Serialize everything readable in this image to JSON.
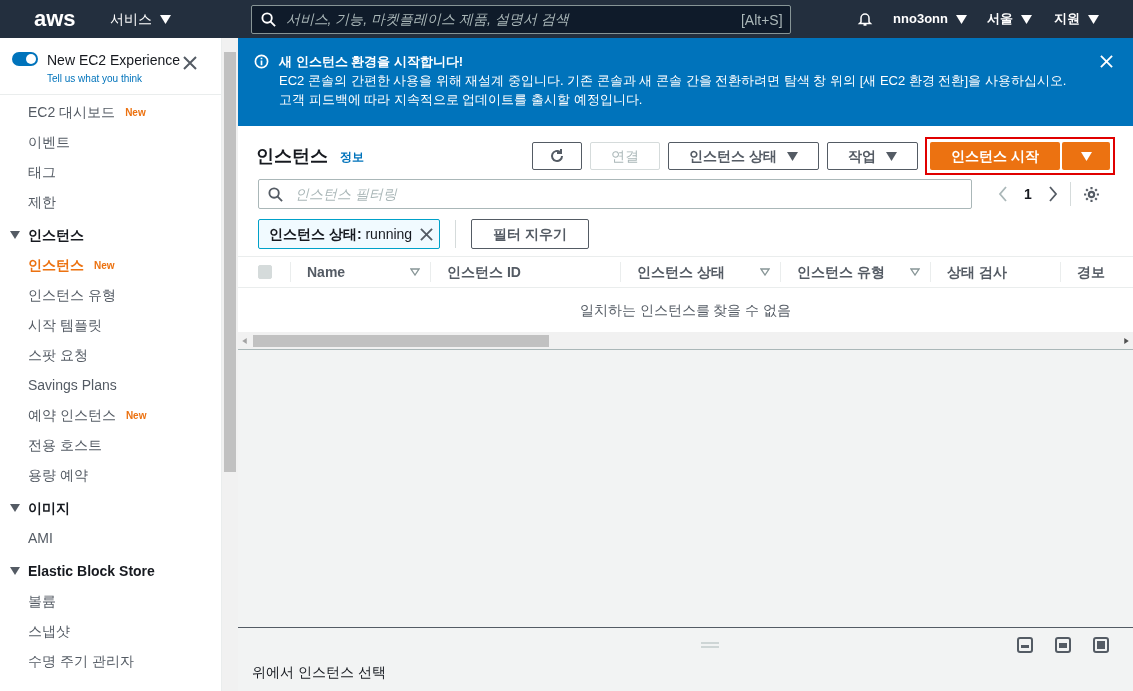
{
  "topbar": {
    "logo": "aws",
    "services": "서비스",
    "search_placeholder": "서비스, 기능, 마켓플레이스 제품, 설명서 검색",
    "search_shortcut": "[Alt+S]",
    "account": "nno3onn",
    "region": "서울",
    "support": "지원"
  },
  "sidebar": {
    "experience": {
      "title": "New EC2 Experience",
      "link": "Tell us what you think",
      "on": true
    },
    "groups": [
      {
        "items": [
          {
            "label": "EC2 대시보드",
            "badge": "New",
            "selected": false
          },
          {
            "label": "이벤트",
            "selected": false
          },
          {
            "label": "태그",
            "selected": false
          },
          {
            "label": "제한",
            "selected": false
          }
        ]
      },
      {
        "heading": "인스턴스",
        "expanded": true,
        "items": [
          {
            "label": "인스턴스",
            "badge": "New",
            "selected": true
          },
          {
            "label": "인스턴스 유형",
            "selected": false
          },
          {
            "label": "시작 템플릿",
            "selected": false
          },
          {
            "label": "스팟 요청",
            "selected": false
          },
          {
            "label": "Savings Plans",
            "selected": false
          },
          {
            "label": "예약 인스턴스",
            "badge": "New",
            "selected": false
          },
          {
            "label": "전용 호스트",
            "selected": false
          },
          {
            "label": "용량 예약",
            "selected": false
          }
        ]
      },
      {
        "heading": "이미지",
        "expanded": true,
        "items": [
          {
            "label": "AMI",
            "selected": false
          }
        ]
      },
      {
        "heading": "Elastic Block Store",
        "expanded": true,
        "items": [
          {
            "label": "볼륨",
            "selected": false
          },
          {
            "label": "스냅샷",
            "selected": false
          },
          {
            "label": "수명 주기 관리자",
            "selected": false
          }
        ]
      }
    ]
  },
  "banner": {
    "title": "새 인스턴스 환경을 시작합니다!",
    "body": "EC2 콘솔의 간편한 사용을 위해 재설계 중입니다. 기존 콘솔과 새 콘솔 간을 전환하려면 탐색 창 위의 [새 EC2 환경 전환]을 사용하십시오. 고객 피드백에 따라 지속적으로 업데이트를 출시할 예정입니다."
  },
  "panel": {
    "title": "인스턴스",
    "info": "정보",
    "connect": {
      "label": "연결",
      "disabled": true
    },
    "state_menu": "인스턴스 상태",
    "actions_menu": "작업",
    "launch": "인스턴스 시작",
    "filter_placeholder": "인스턴스 필터링",
    "page": "1",
    "filter_token": {
      "key": "인스턴스 상태:",
      "value": "running"
    },
    "clear_filters": "필터 지우기",
    "select_all": {
      "checked": false,
      "disabled": true
    },
    "columns": [
      {
        "label": "Name",
        "sortable": true
      },
      {
        "label": "인스턴스 ID",
        "sortable": false
      },
      {
        "label": "인스턴스 상태",
        "sortable": true
      },
      {
        "label": "인스턴스 유형",
        "sortable": true
      },
      {
        "label": "상태 검사",
        "sortable": false
      },
      {
        "label": "경보",
        "sortable": false
      }
    ],
    "empty": "일치하는 인스턴스를 찾을 수 없음"
  },
  "split_panel": {
    "message": "위에서 인스턴스 선택"
  }
}
